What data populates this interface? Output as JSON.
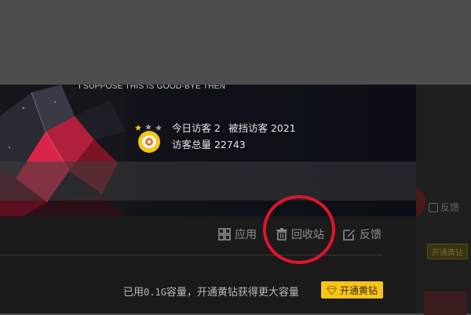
{
  "banner": {
    "tagline": "I SUPPOSE THIS IS GOOD-BYE THEN"
  },
  "stats": {
    "today_label": "今日访客",
    "today_value": "2",
    "blocked_label": "被挡访客",
    "blocked_value": "2021",
    "total_label": "访客总量",
    "total_value": "22743",
    "star_rating": 1,
    "star_max": 3
  },
  "toolbar": {
    "apps_label": "应用",
    "recycle_label": "回收站",
    "feedback_label": "反馈"
  },
  "storage": {
    "used_prefix": "已用",
    "used_value": "0.1G",
    "used_suffix": "容量，开通黄钻获得更大容量",
    "upgrade_label": "开通黄钻"
  },
  "right_strip": {
    "feedback_label": "反馈",
    "badge_label": "开通黄钻"
  },
  "colors": {
    "accent_yellow": "#f5c518",
    "highlight_red": "#e0142a",
    "panel_bg": "#1a1a1a"
  },
  "icons": [
    "apps-grid-icon",
    "trash-icon",
    "edit-icon",
    "diamond-icon",
    "eye-avatar-icon",
    "star-icon"
  ]
}
